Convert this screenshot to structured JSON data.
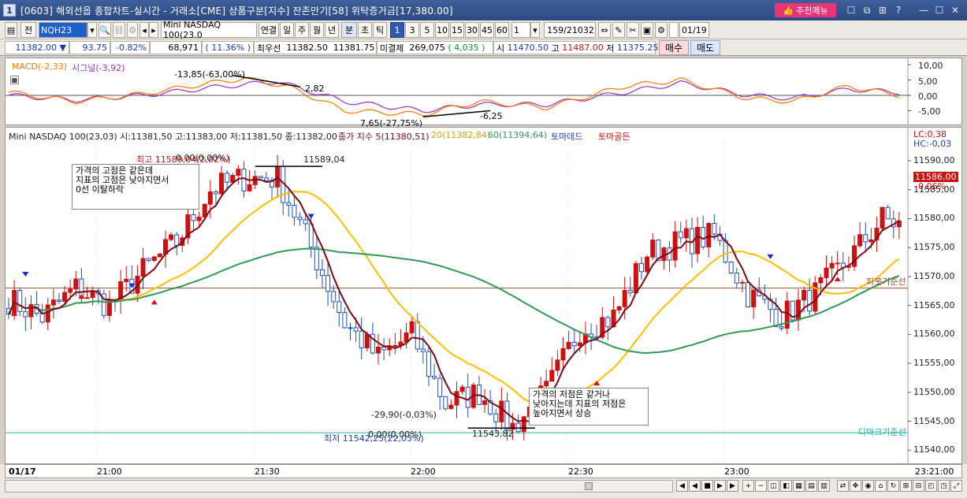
{
  "title": {
    "screen_no": "1",
    "text": "[0603] 해외선옵 종합차트-실시간 - 거래소[CME] 상품구분[지수] 잔존만기[58] 위탁증거금[17,380.00]",
    "reco_button": "추천메뉴",
    "window_buttons": [
      "☐",
      "⧉",
      "⊞",
      "?",
      "—",
      "☐",
      "✕"
    ]
  },
  "toolbar": {
    "mode": "전",
    "code": "NQH23",
    "product": "Mini NASDAQ 100(23.0",
    "link": "연결",
    "periods": [
      "일",
      "주",
      "월",
      "년",
      "분",
      "초",
      "틱"
    ],
    "selected_period": "분",
    "intervals": [
      "1",
      "3",
      "5",
      "10",
      "15",
      "30",
      "45",
      "60"
    ],
    "selected_interval": "1",
    "interval_value": "1",
    "count": "159",
    "total": "21032",
    "date": "01/19"
  },
  "quote": {
    "price": "11382.00",
    "change_arrow": "▼",
    "change": "93.75",
    "change_pct": "-0.82%",
    "volume": "68,971",
    "vol_ratio": "( 11.36% )",
    "best_label": "최우선",
    "best_ask": "11382.50",
    "best_bid": "11381.75",
    "open_int_label": "미결제",
    "open_int": "269,075",
    "open_int_change": "( 4,035 )",
    "open_label": "시",
    "open": "11470.50",
    "high_label": "고",
    "high": "11487.00",
    "low_label": "저",
    "low": "11375.25",
    "buy": "매수",
    "sell": "매도"
  },
  "macd_panel": {
    "legend_macd": "MACD(-2,33)",
    "legend_signal": "시그널(-3,92)",
    "ann_peak_pct": "-13,85(-63,00%)",
    "ann_peak_val": "2,82",
    "ann_trough_pct": "7,65(-27,75%)",
    "ann_trough_val": "-6,25",
    "y_ticks": [
      "10,00",
      "5,00",
      "0,00",
      "-5,00"
    ],
    "colors": {
      "macd": "#ff7a00",
      "signal": "#9b30c0",
      "zero": "#555555"
    }
  },
  "price_panel": {
    "header": "Mini NASDAQ 100(23,03) 시:11381,50 고:11383,00 저:11381,50 종:11382,00",
    "ma_label": "종가 지수 5(11380,51)",
    "ma20_label": "20(11382,84)",
    "ma60_label": "60(11394,64)",
    "tornado_down": "토마데드",
    "tornado_up": "토마골든",
    "lc": "LC:0,38",
    "hc": "HC:-0,03",
    "last_price": "11586,00",
    "last_pct": "0,06%",
    "hi_label": "최고 11589,04(2,02%)",
    "hi_pct": "0,00(0,00%)",
    "hi_value": "11589,04",
    "lo_label": "최저 11542,25(22,03%)",
    "lo_pct": "0,00(0,00%)",
    "lo_value": "11543,82",
    "low_diff": "-29,90(-0,03%)",
    "note1": [
      "가격의 고점은 같은데",
      "지표의 고점은 낮아지면서",
      "0선 이탈하락"
    ],
    "note2": [
      "가격의 저점은 같거나",
      "낮아지는데 지표의 저점은",
      "높아지면서 상승"
    ],
    "pivot_label": "피봇기준선",
    "demark_label": "디마크기준선",
    "y_ticks": [
      "11590,00",
      "11585,00",
      "11580,00",
      "11575,00",
      "11570,00",
      "11565,00",
      "11560,00",
      "11555,00",
      "11550,00",
      "11545,00",
      "11540,00"
    ],
    "colors": {
      "up": "#cc1111",
      "down": "#1f4fc0",
      "ma5": "#7a0a14",
      "ma20": "#ffbe00",
      "ma60": "#2f9a56",
      "pivot": "#a0522d",
      "demark": "#20b2aa"
    }
  },
  "time_axis": {
    "date_label": "01/17",
    "labels": [
      "21:00",
      "21:30",
      "22:00",
      "22:30",
      "23:00"
    ],
    "end_time": "23:21:00"
  },
  "chart_data": {
    "type": "candlestick",
    "symbol": "Mini NASDAQ 100(23,03)",
    "y_range": [
      11538,
      11593
    ],
    "x_range": [
      "20:46",
      "23:21"
    ],
    "bar_interval": "1 minute",
    "highest": 11589.04,
    "lowest": 11543.82,
    "pivot_line": 11568,
    "demark_line": 11543,
    "last_close": 11586.0,
    "close_path_ma5": [
      [
        0,
        11566
      ],
      [
        6,
        11563
      ],
      [
        12,
        11568
      ],
      [
        18,
        11565
      ],
      [
        24,
        11571
      ],
      [
        30,
        11576
      ],
      [
        36,
        11585
      ],
      [
        42,
        11587
      ],
      [
        48,
        11587
      ],
      [
        54,
        11575
      ],
      [
        60,
        11562
      ],
      [
        66,
        11556
      ],
      [
        72,
        11560
      ],
      [
        78,
        11548
      ],
      [
        84,
        11550
      ],
      [
        90,
        11544
      ],
      [
        96,
        11550
      ],
      [
        102,
        11561
      ],
      [
        108,
        11563
      ],
      [
        114,
        11574
      ],
      [
        120,
        11576
      ],
      [
        126,
        11577
      ],
      [
        132,
        11567
      ],
      [
        138,
        11563
      ],
      [
        144,
        11567
      ],
      [
        150,
        11573
      ],
      [
        156,
        11580
      ],
      [
        159,
        11579
      ]
    ],
    "macd_path": [
      [
        0,
        1.0
      ],
      [
        12,
        -2
      ],
      [
        24,
        0.5
      ],
      [
        36,
        4
      ],
      [
        42,
        5.5
      ],
      [
        50,
        2.8
      ],
      [
        60,
        -5
      ],
      [
        74,
        -6.2
      ],
      [
        84,
        -2
      ],
      [
        96,
        -4
      ],
      [
        110,
        3
      ],
      [
        120,
        5
      ],
      [
        132,
        -1
      ],
      [
        140,
        -2
      ],
      [
        150,
        3
      ],
      [
        159,
        0
      ]
    ],
    "signal_path": [
      [
        0,
        0
      ],
      [
        12,
        -1.5
      ],
      [
        24,
        0
      ],
      [
        36,
        2.5
      ],
      [
        48,
        4.5
      ],
      [
        60,
        -2
      ],
      [
        74,
        -5
      ],
      [
        84,
        -3
      ],
      [
        96,
        -3
      ],
      [
        110,
        1
      ],
      [
        120,
        4
      ],
      [
        132,
        0
      ],
      [
        140,
        -1
      ],
      [
        150,
        2
      ],
      [
        159,
        1
      ]
    ]
  }
}
